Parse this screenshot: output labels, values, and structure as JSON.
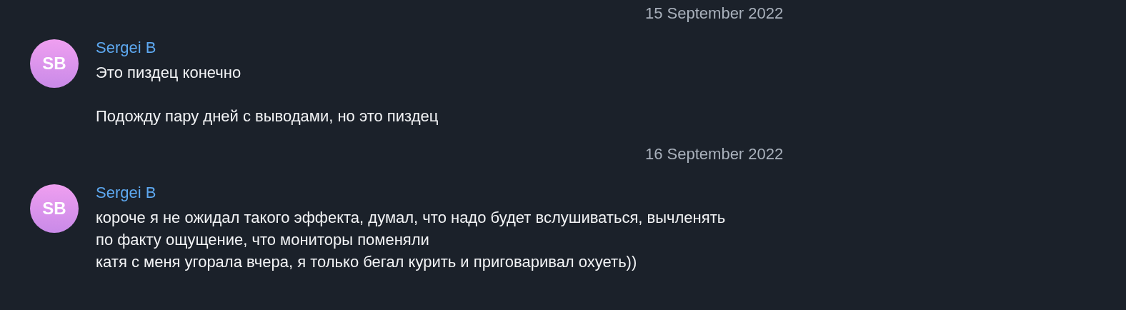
{
  "messages": [
    {
      "date": "15 September 2022",
      "avatar": "SB",
      "author": "Sergei B",
      "paragraphs": [
        "Это пиздец конечно",
        "Подожду пару дней с выводами, но это пиздец"
      ]
    },
    {
      "date": "16 September 2022",
      "avatar": "SB",
      "author": "Sergei B",
      "paragraphs": [
        "короче я не ожидал такого эффекта, думал, что надо будет вслушиваться, вычленять\nпо факту ощущение, что мониторы поменяли\nкатя с меня угорала вчера, я только бегал курить и приговаривал охуеть))"
      ]
    }
  ]
}
